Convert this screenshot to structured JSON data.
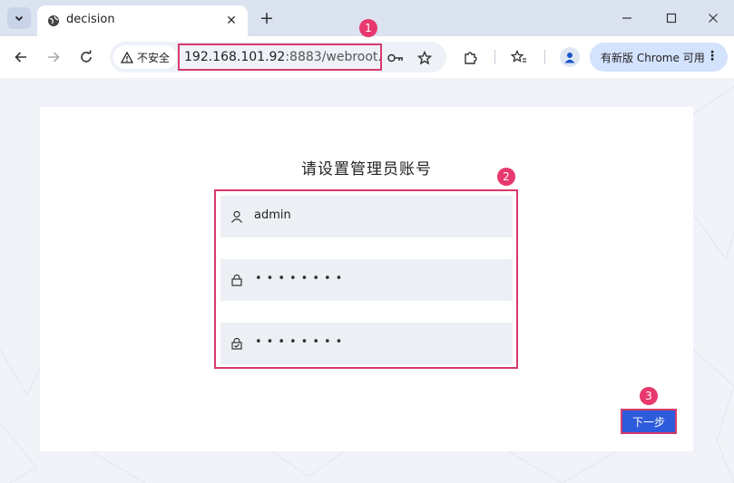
{
  "browser": {
    "tab": {
      "title": "decision"
    },
    "address": {
      "security_label": "不安全",
      "url_host": "192.168.101.92",
      "url_rest": ":8883/webroot..."
    },
    "update_button": "有新版 Chrome 可用",
    "window_controls": [
      "minimize",
      "maximize",
      "close"
    ]
  },
  "page": {
    "title": "请设置管理员账号",
    "fields": [
      {
        "icon": "user-icon",
        "value": "admin"
      },
      {
        "icon": "lock-icon",
        "value": "••••••••"
      },
      {
        "icon": "lock-check-icon",
        "value": "••••••••"
      }
    ],
    "next_button": "下一步"
  },
  "annotations": [
    "1",
    "2",
    "3"
  ],
  "colors": {
    "annotation_pink": "#e8396e",
    "button_blue": "#2e5bdb",
    "highlight_border": "#d63a6a"
  }
}
